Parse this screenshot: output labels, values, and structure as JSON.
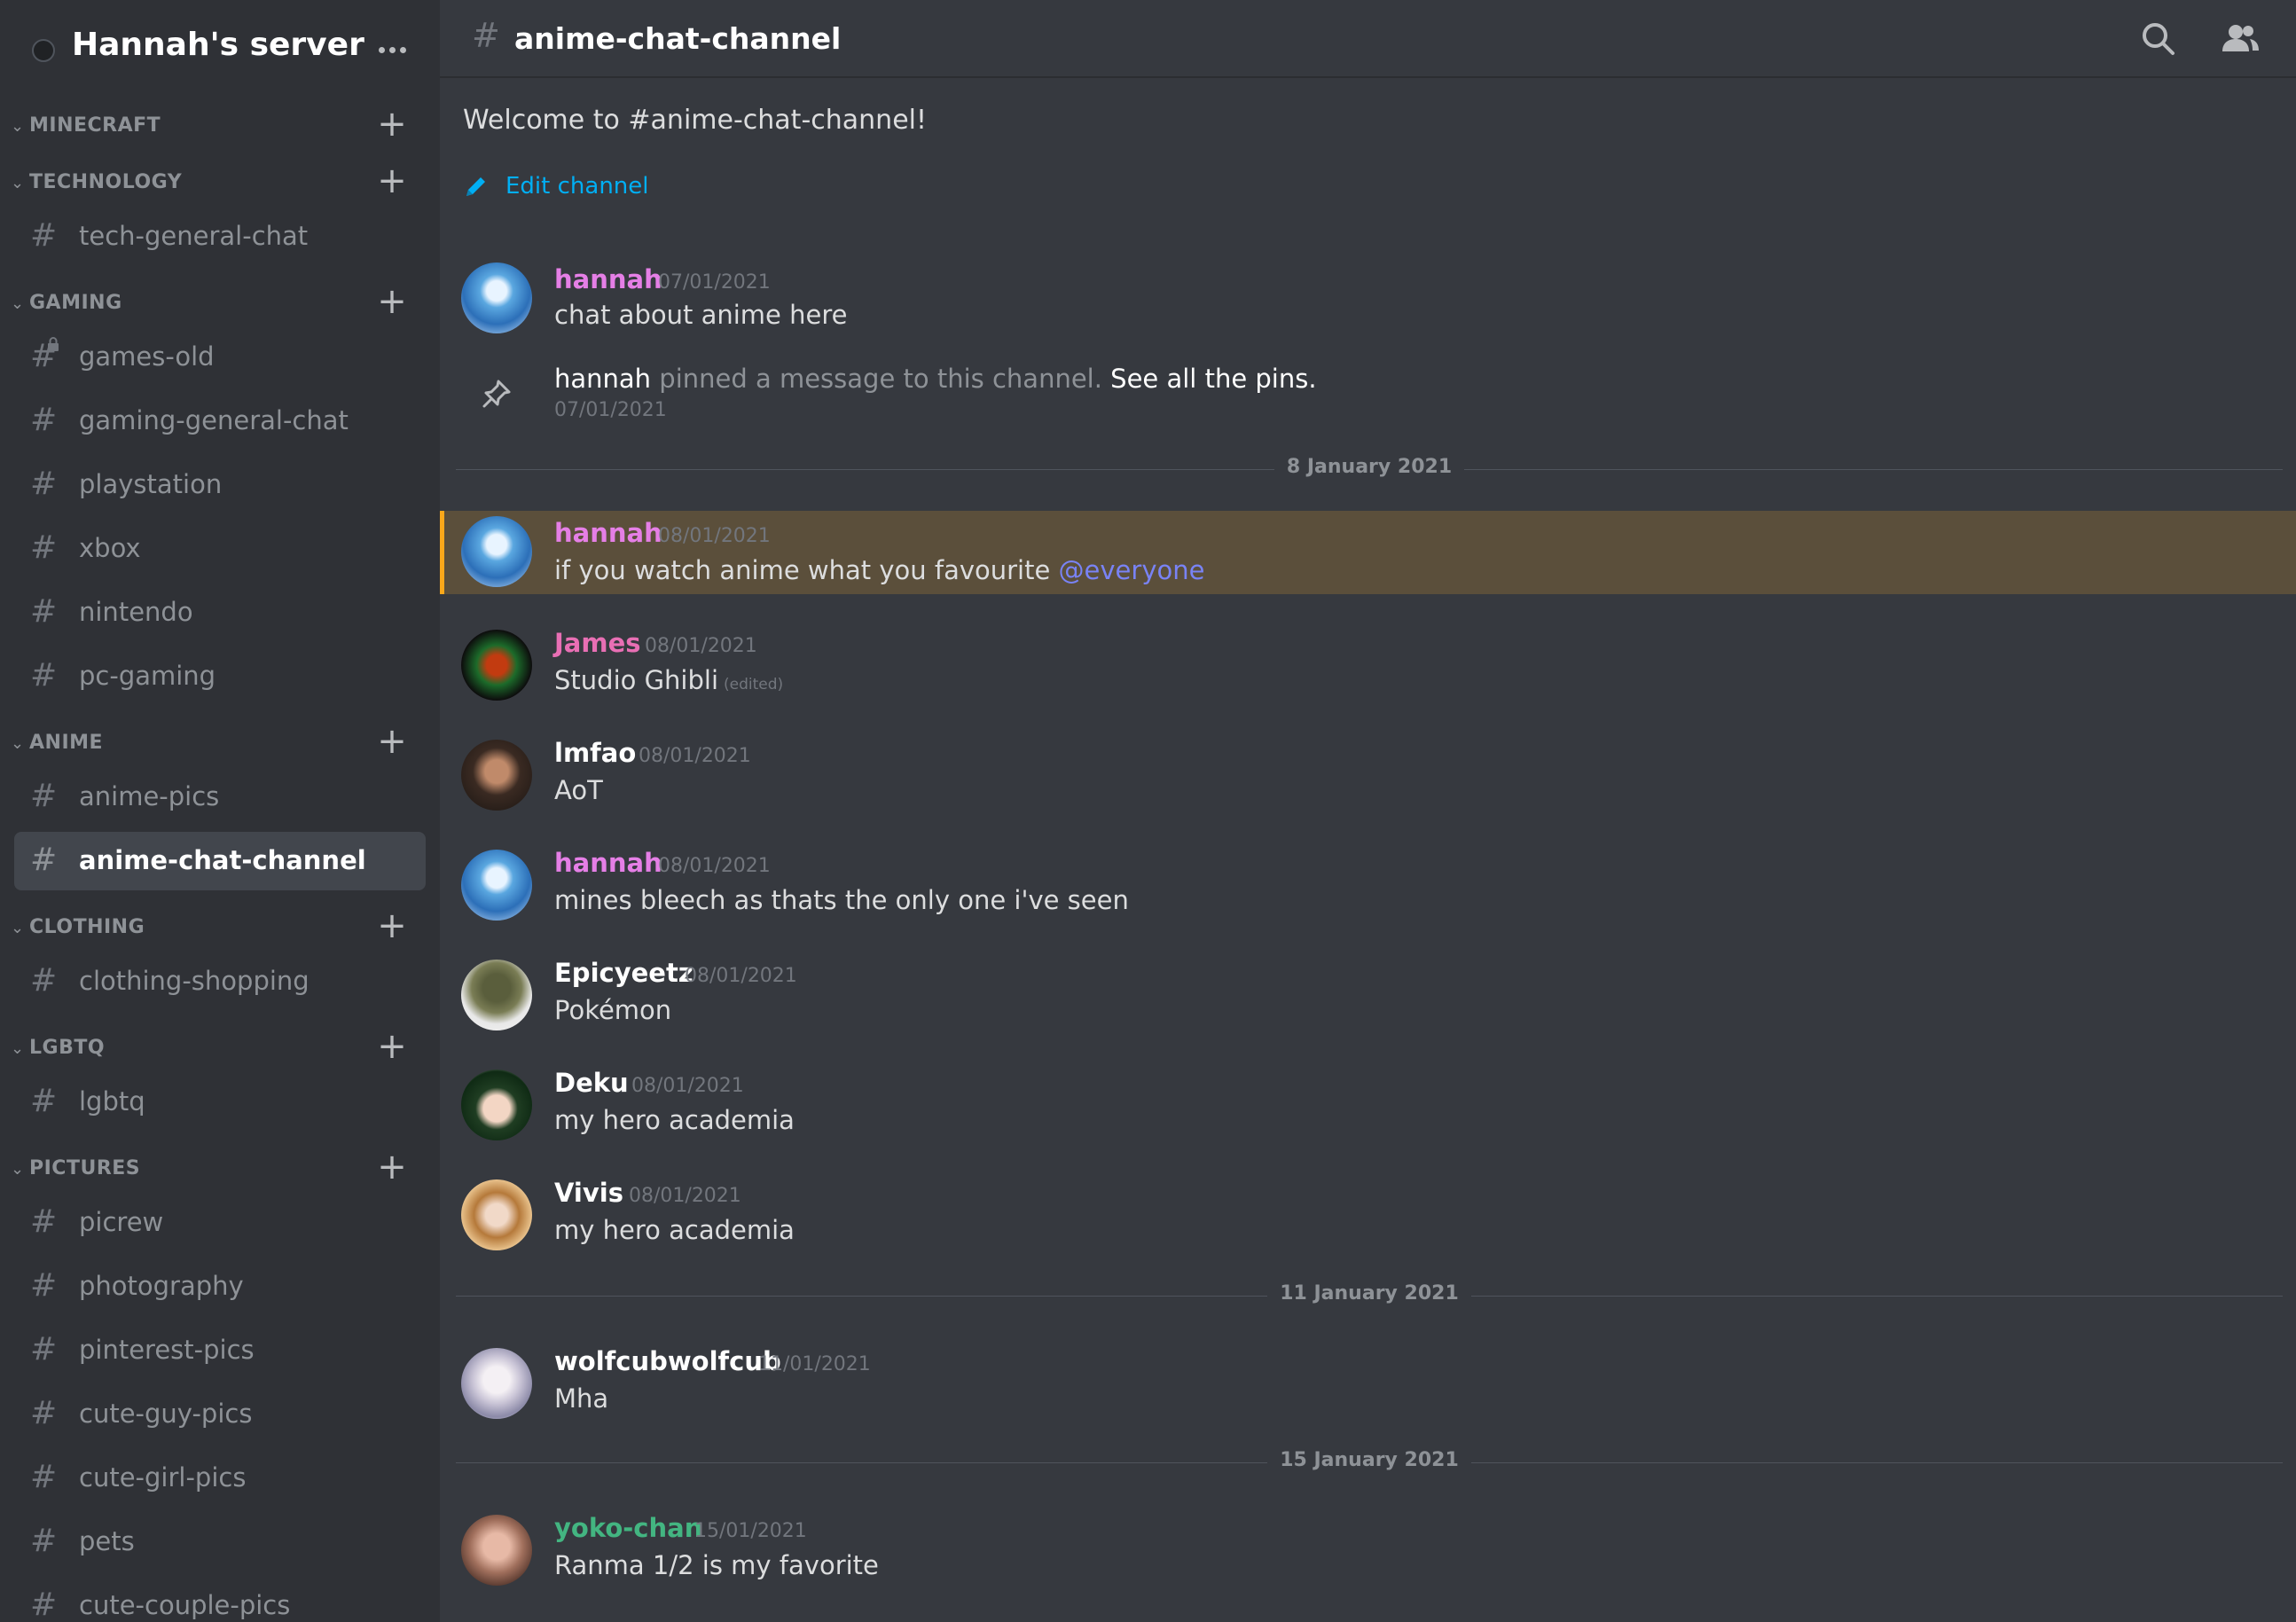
{
  "server": {
    "name": "Hannah's server"
  },
  "sidebar": {
    "categories": [
      {
        "label": "MINECRAFT",
        "channels": []
      },
      {
        "label": "TECHNOLOGY",
        "channels": [
          "tech-general-chat"
        ]
      },
      {
        "label": "GAMING",
        "channels": [
          "games-old",
          "gaming-general-chat",
          "playstation",
          "xbox",
          "nintendo",
          "pc-gaming"
        ]
      },
      {
        "label": "ANIME",
        "channels": [
          "anime-pics",
          "anime-chat-channel"
        ]
      },
      {
        "label": "CLOTHING",
        "channels": [
          "clothing-shopping"
        ]
      },
      {
        "label": "LGBTQ",
        "channels": [
          "lgbtq"
        ]
      },
      {
        "label": "PICTURES",
        "channels": [
          "picrew",
          "photography",
          "pinterest-pics",
          "cute-guy-pics",
          "cute-girl-pics",
          "pets",
          "cute-couple-pics"
        ]
      }
    ],
    "active_channel": "anime-chat-channel",
    "locked_channel": "games-old"
  },
  "channel": {
    "name": "anime-chat-channel",
    "welcome": "Welcome to #anime-chat-channel!",
    "edit_label": "Edit channel"
  },
  "pin_notice": {
    "user": "hannah",
    "text": " pinned a message to this channel. ",
    "link": "See all the pins.",
    "date": "07/01/2021"
  },
  "dividers": [
    "8 January 2021",
    "11 January 2021",
    "15 January 2021"
  ],
  "messages": [
    {
      "author": "hannah",
      "color": "#e57fe6",
      "date": "07/01/2021",
      "text": "chat about anime here"
    },
    {
      "author": "hannah",
      "color": "#e57fe6",
      "date": "08/01/2021",
      "text": "if you watch anime what you favourite ",
      "mention": "@everyone"
    },
    {
      "author": "James",
      "color": "#e86fb4",
      "date": "08/01/2021",
      "text": "Studio Ghibli",
      "edited": "(edited)"
    },
    {
      "author": "lmfao",
      "color": "#ffffff",
      "date": "08/01/2021",
      "text": "AoT"
    },
    {
      "author": "hannah",
      "color": "#e57fe6",
      "date": "08/01/2021",
      "text": "mines bleech as thats the only one i've seen"
    },
    {
      "author": "Epicyeetz",
      "color": "#ffffff",
      "date": "08/01/2021",
      "text": "Pokémon"
    },
    {
      "author": "Deku",
      "color": "#ffffff",
      "date": "08/01/2021",
      "text": "my hero academia"
    },
    {
      "author": "Vivis",
      "color": "#ffffff",
      "date": "08/01/2021",
      "text": "my hero academia"
    },
    {
      "author": "wolfcubwolfcub",
      "color": "#ffffff",
      "date": "11/01/2021",
      "text": "Mha"
    },
    {
      "author": "yoko-chan",
      "color": "#43b581",
      "date": "15/01/2021",
      "text": "Ranma 1/2 is my favorite"
    }
  ],
  "icons": {
    "search": "search-icon",
    "members": "members-icon",
    "pin": "pin-icon",
    "pencil": "pencil-icon"
  }
}
